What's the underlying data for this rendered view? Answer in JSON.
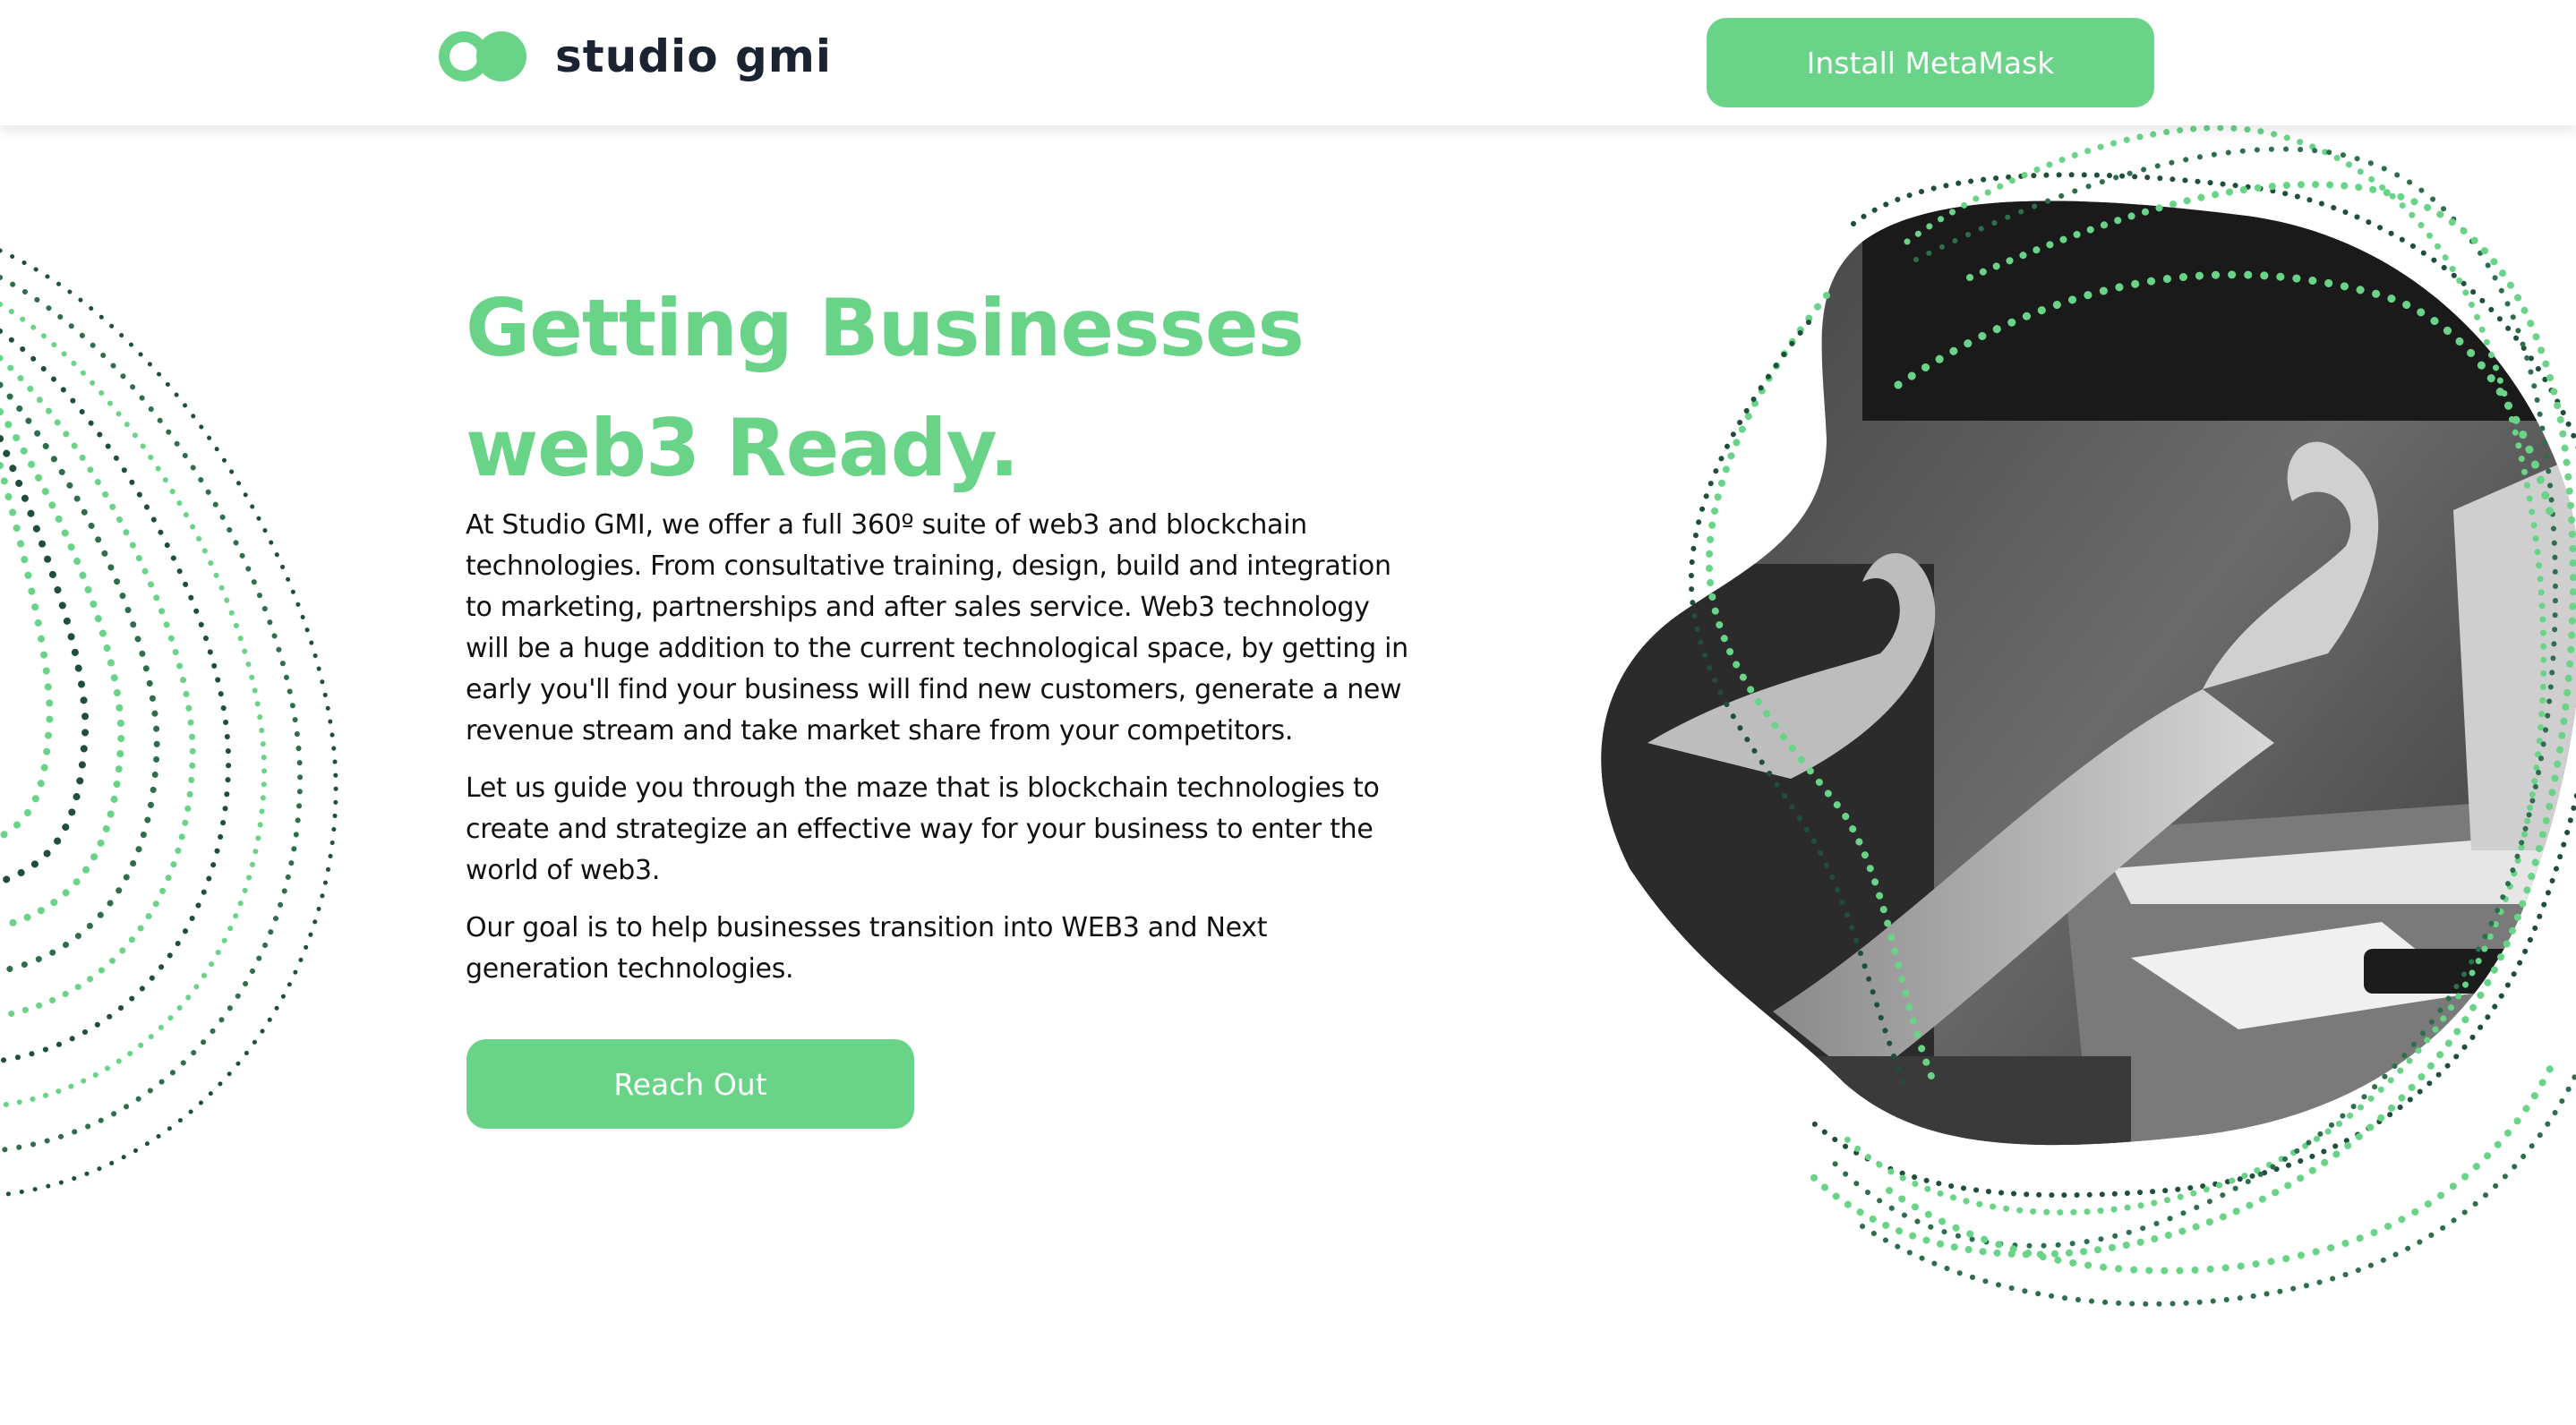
{
  "header": {
    "brand_name": "studio gmi",
    "install_label": "Install MetaMask"
  },
  "hero": {
    "title_line_1": "Getting Businesses",
    "title_line_2": "web3 Ready.",
    "paragraph_1": "At Studio GMI, we offer a full 360º suite of web3 and blockchain technologies. From consultative training, design, build and integration to marketing, partnerships and after sales service. Web3 technology will be a huge addition to the current technological space, by getting in early you'll find your business will find new customers, generate a new revenue stream and take market share from your competitors.",
    "paragraph_2": "Let us guide you through the maze that is blockchain technologies to create and strategize an effective way for your business to enter the world of web3.",
    "paragraph_3": "Our goal is to help businesses transition into WEB3 and Next generation technologies.",
    "cta_label": "Reach Out"
  },
  "colors": {
    "accent": "#69d488",
    "dark_dots": "#1f4f3a",
    "text": "#111111",
    "brand_text": "#1b2333"
  },
  "icons": {
    "logo": "studio-gmi-logo-icon"
  }
}
